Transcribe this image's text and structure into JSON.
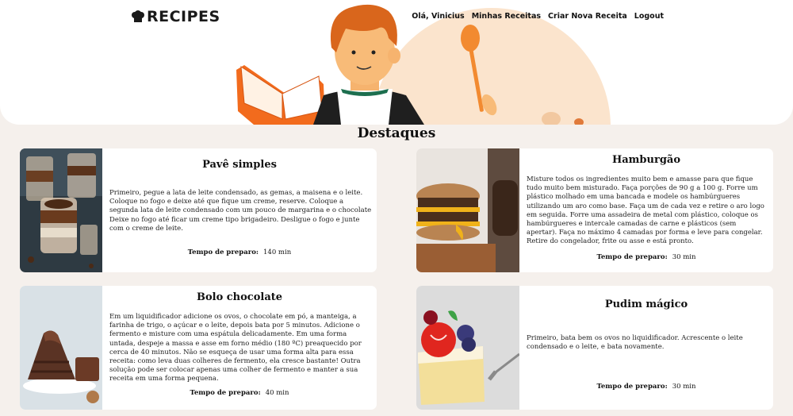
{
  "header": {
    "logo": "RECIPES",
    "nav": [
      "Olá, Vinicius",
      "Minhas Receitas",
      "Criar Nova Receita",
      "Logout"
    ]
  },
  "section": {
    "title": "Destaques"
  },
  "recipes": [
    {
      "title": "Pavê simples",
      "description": "Primeiro, pegue a lata de leite condensado, as gemas, a maisena e o leite. Coloque no fogo e deixe até que fique um creme, reserve. Coloque a segunda lata de leite condensado com um pouco de margarina e o chocolate Deixe no fogo até ficar um creme tipo brigadeiro. Desligue o fogo e junte com o creme de leite.",
      "time_label": "Tempo de preparo:",
      "time": "140 min"
    },
    {
      "title": "Hamburgão",
      "description": "Misture todos os ingredientes muito bem e amasse para que fique tudo muito bem misturado. Faça porções de 90 g a 100 g. Forre um plástico molhado em uma bancada e modele os hambúrgueres utilizando um aro como base. Faça um de cada vez e retire o aro logo em seguida. Forre uma assadeira de metal com plástico, coloque os hambúrgueres e intercale camadas de carne e plásticos (sem apertar). Faça no máximo 4 camadas por forma e leve para congelar. Retire do congelador, frite ou asse e está pronto.",
      "time_label": "Tempo de preparo:",
      "time": "30 min"
    },
    {
      "title": "Bolo chocolate",
      "description": "Em um liquidificador adicione os ovos, o chocolate em pó, a manteiga, a farinha de trigo, o açúcar e o leite, depois bata por 5 minutos. Adicione o fermento e misture com uma espátula delicadamente. Em uma forma untada, despeje a massa e asse em forno médio (180 ºC) preaquecido por cerca de 40 minutos. Não se esqueça de usar uma forma alta para essa receita: como leva duas colheres de fermento, ela cresce bastante! Outra solução pode ser colocar apenas uma colher de fermento e manter a sua receita em uma forma pequena.",
      "time_label": "Tempo de preparo:",
      "time": "40 min"
    },
    {
      "title": "Pudim mágico",
      "description": "Primeiro, bata bem os ovos no liquidificador. Acrescente o leite condensado e o leite, e bata novamente.",
      "time_label": "Tempo de preparo:",
      "time": "30 min"
    }
  ]
}
